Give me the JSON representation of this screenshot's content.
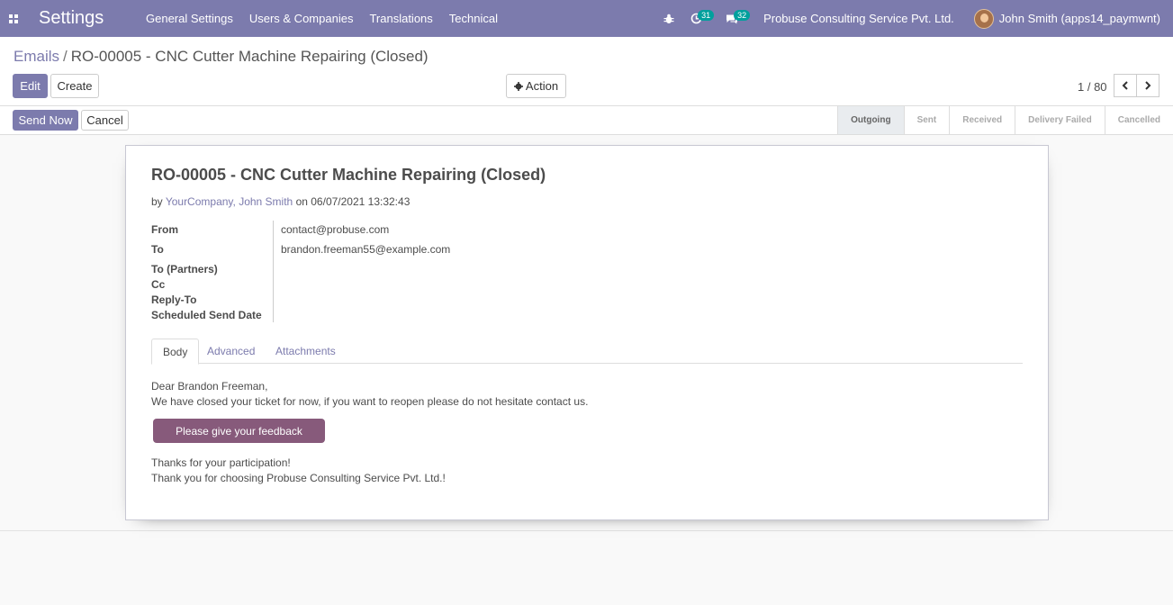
{
  "navbar": {
    "app_title": "Settings",
    "menu": [
      "General Settings",
      "Users & Companies",
      "Translations",
      "Technical"
    ],
    "activity_count": "31",
    "message_count": "32",
    "company": "Probuse Consulting Service Pvt. Ltd.",
    "user": "John Smith (apps14_paymwnt)"
  },
  "breadcrumb": {
    "parent": "Emails",
    "separator": "/",
    "current": "RO-00005 - CNC Cutter Machine Repairing (Closed)"
  },
  "buttons": {
    "edit": "Edit",
    "create": "Create",
    "action": "Action",
    "send_now": "Send Now",
    "cancel": "Cancel"
  },
  "pager": {
    "value": "1 / 80"
  },
  "stages": [
    "Outgoing",
    "Sent",
    "Received",
    "Delivery Failed",
    "Cancelled"
  ],
  "email": {
    "subject": "RO-00005 - CNC Cutter Machine Repairing (Closed)",
    "by_prefix": "by",
    "author": "YourCompany, John Smith",
    "on_date": "on 06/07/2021 13:32:43",
    "fields": {
      "from_label": "From",
      "from_value": "contact@probuse.com",
      "to_label": "To",
      "to_value": "brandon.freeman55@example.com",
      "to_partners_label": "To (Partners)",
      "cc_label": "Cc",
      "reply_to_label": "Reply-To",
      "scheduled_label": "Scheduled Send Date"
    },
    "tabs": [
      "Body",
      "Advanced",
      "Attachments"
    ],
    "body": {
      "greeting": "Dear Brandon Freeman,",
      "line1": "We have closed your ticket for now, if you want to reopen please do not hesitate contact us.",
      "feedback_button": "Please give your feedback",
      "thanks": "Thanks for your participation!",
      "closing": "Thank you for choosing Probuse Consulting Service Pvt. Ltd.!"
    }
  }
}
